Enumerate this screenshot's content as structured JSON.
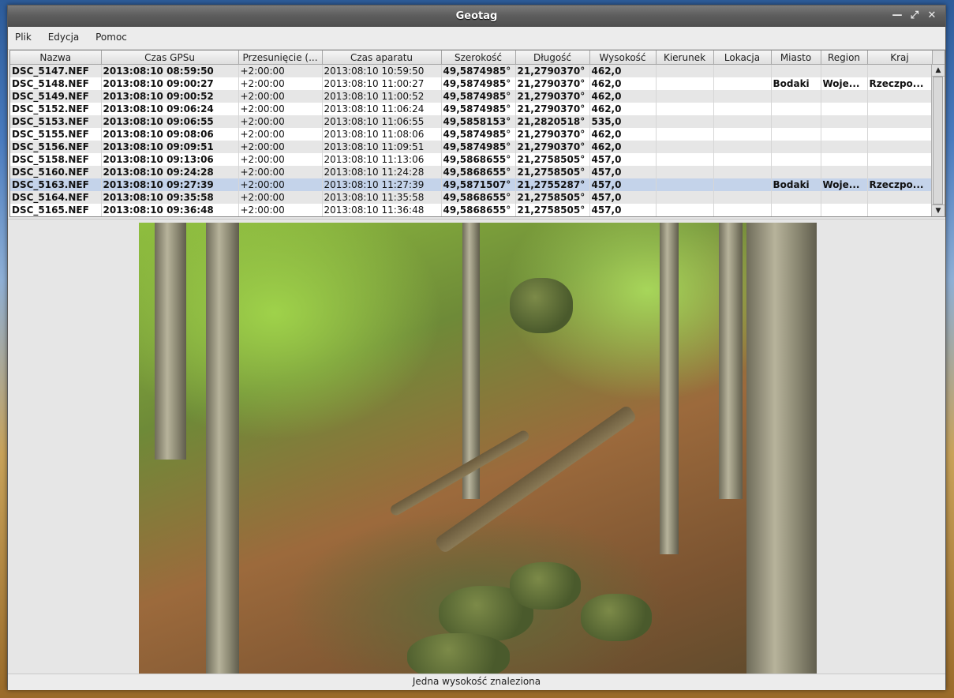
{
  "window": {
    "title": "Geotag"
  },
  "menu": {
    "items": [
      "Plik",
      "Edycja",
      "Pomoc"
    ]
  },
  "table": {
    "headers": [
      "Nazwa",
      "Czas GPSu",
      "Przesunięcie (...",
      "Czas aparatu",
      "Szerokość",
      "Długość",
      "Wysokość",
      "Kierunek",
      "Lokacja",
      "Miasto",
      "Region",
      "Kraj"
    ],
    "rows": [
      [
        "DSC_5147.NEF",
        "2013:08:10 08:59:50",
        "+2:00:00",
        "2013:08:10 10:59:50",
        "49,5874985°",
        "21,2790370°",
        "462,0",
        "",
        "",
        "",
        "",
        ""
      ],
      [
        "DSC_5148.NEF",
        "2013:08:10 09:00:27",
        "+2:00:00",
        "2013:08:10 11:00:27",
        "49,5874985°",
        "21,2790370°",
        "462,0",
        "",
        "",
        "Bodaki",
        "Woje...",
        "Rzeczpo..."
      ],
      [
        "DSC_5149.NEF",
        "2013:08:10 09:00:52",
        "+2:00:00",
        "2013:08:10 11:00:52",
        "49,5874985°",
        "21,2790370°",
        "462,0",
        "",
        "",
        "",
        "",
        ""
      ],
      [
        "DSC_5152.NEF",
        "2013:08:10 09:06:24",
        "+2:00:00",
        "2013:08:10 11:06:24",
        "49,5874985°",
        "21,2790370°",
        "462,0",
        "",
        "",
        "",
        "",
        ""
      ],
      [
        "DSC_5153.NEF",
        "2013:08:10 09:06:55",
        "+2:00:00",
        "2013:08:10 11:06:55",
        "49,5858153°",
        "21,2820518°",
        "535,0",
        "",
        "",
        "",
        "",
        ""
      ],
      [
        "DSC_5155.NEF",
        "2013:08:10 09:08:06",
        "+2:00:00",
        "2013:08:10 11:08:06",
        "49,5874985°",
        "21,2790370°",
        "462,0",
        "",
        "",
        "",
        "",
        ""
      ],
      [
        "DSC_5156.NEF",
        "2013:08:10 09:09:51",
        "+2:00:00",
        "2013:08:10 11:09:51",
        "49,5874985°",
        "21,2790370°",
        "462,0",
        "",
        "",
        "",
        "",
        ""
      ],
      [
        "DSC_5158.NEF",
        "2013:08:10 09:13:06",
        "+2:00:00",
        "2013:08:10 11:13:06",
        "49,5868655°",
        "21,2758505°",
        "457,0",
        "",
        "",
        "",
        "",
        ""
      ],
      [
        "DSC_5160.NEF",
        "2013:08:10 09:24:28",
        "+2:00:00",
        "2013:08:10 11:24:28",
        "49,5868655°",
        "21,2758505°",
        "457,0",
        "",
        "",
        "",
        "",
        ""
      ],
      [
        "DSC_5163.NEF",
        "2013:08:10 09:27:39",
        "+2:00:00",
        "2013:08:10 11:27:39",
        "49,5871507°",
        "21,2755287°",
        "457,0",
        "",
        "",
        "Bodaki",
        "Woje...",
        "Rzeczpo..."
      ],
      [
        "DSC_5164.NEF",
        "2013:08:10 09:35:58",
        "+2:00:00",
        "2013:08:10 11:35:58",
        "49,5868655°",
        "21,2758505°",
        "457,0",
        "",
        "",
        "",
        "",
        ""
      ],
      [
        "DSC_5165.NEF",
        "2013:08:10 09:36:48",
        "+2:00:00",
        "2013:08:10 11:36:48",
        "49,5868655°",
        "21,2758505°",
        "457,0",
        "",
        "",
        "",
        "",
        ""
      ]
    ],
    "selected_index": 9
  },
  "status": {
    "text": "Jedna wysokość znaleziona"
  },
  "icons": {
    "minimize": "minimize-icon",
    "maximize": "maximize-icon",
    "close": "close-icon"
  }
}
